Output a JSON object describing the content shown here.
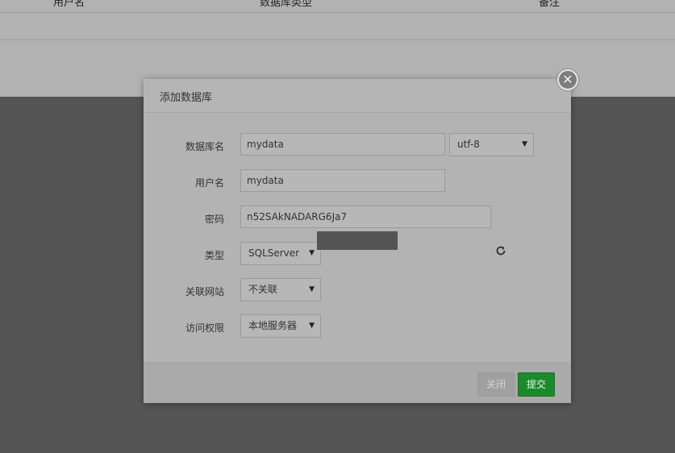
{
  "background": {
    "col1": "用户名",
    "col2": "数据库类型",
    "col3": "备注"
  },
  "dialog": {
    "title": "添加数据库",
    "close_symbol": "✕",
    "fields": {
      "dbname_label": "数据库名",
      "dbname_value": "mydata",
      "charset_value": "utf-8",
      "username_label": "用户名",
      "username_value": "mydata",
      "password_label": "密码",
      "password_value": "n52SAkNADARG6Ja7",
      "type_label": "类型",
      "type_value": "SQLServer",
      "site_label": "关联网站",
      "site_value": "不关联",
      "access_label": "访问权限",
      "access_value": "本地服务器"
    },
    "select_arrow": "▼",
    "buttons": {
      "close": "关闭",
      "submit": "提交"
    }
  },
  "colors": {
    "submit_green": "#1b8a2c",
    "overlay": "rgba(0,0,0,0.30)"
  },
  "icons": {
    "close": "close-icon",
    "refresh": "refresh-icon",
    "dropdown": "chevron-down-icon"
  }
}
